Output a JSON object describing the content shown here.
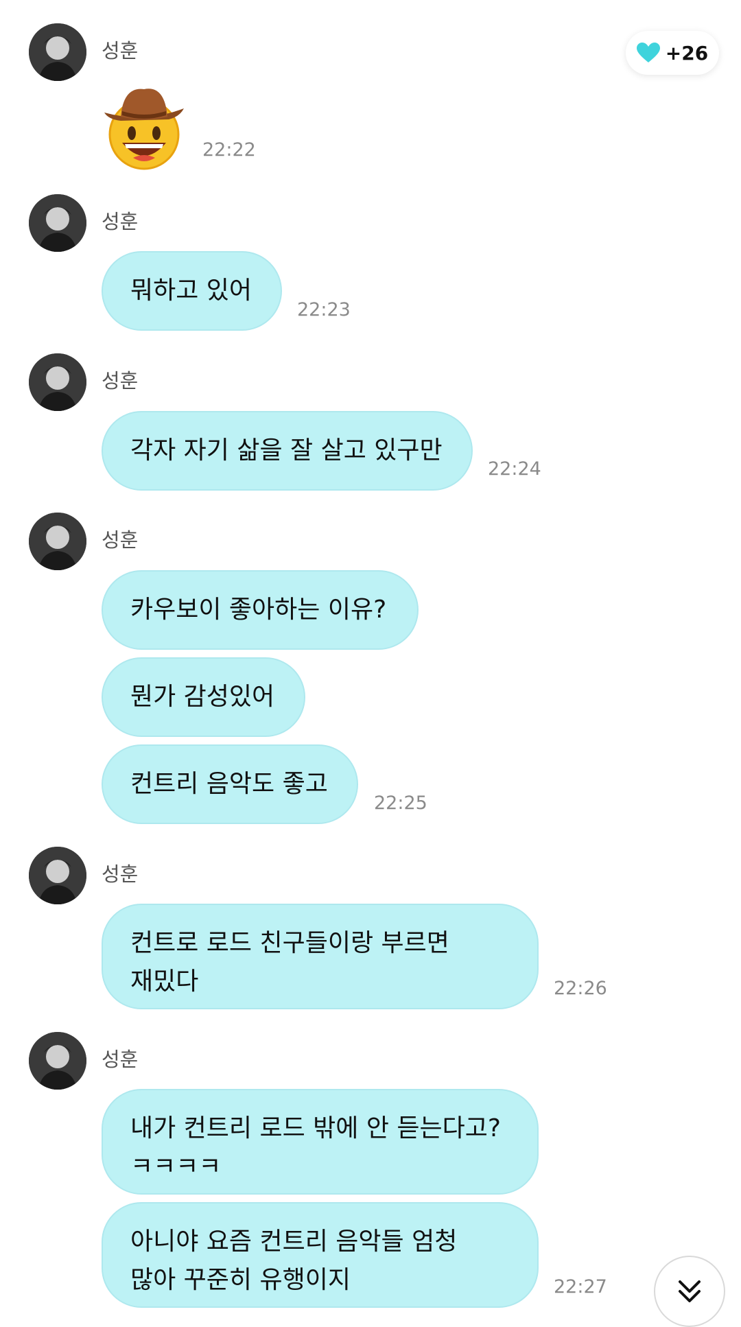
{
  "heart_badge": {
    "count": "+26",
    "color": "#3fd3dc"
  },
  "sender": "성훈",
  "messages": [
    {
      "name": "성훈",
      "emoji": "cowboy-hat-face",
      "time": "22:22"
    },
    {
      "name": "성훈",
      "bubbles": [
        "뭐하고 있어"
      ],
      "time": "22:23"
    },
    {
      "name": "성훈",
      "bubbles": [
        "각자 자기 삶을 잘 살고 있구만"
      ],
      "time": "22:24"
    },
    {
      "name": "성훈",
      "bubbles": [
        "카우보이 좋아하는 이유?",
        "뭔가 감성있어",
        "컨트리 음악도 좋고"
      ],
      "time": "22:25"
    },
    {
      "name": "성훈",
      "bubbles": [
        "컨트로 로드 친구들이랑 부르면\n재밌다"
      ],
      "time": "22:26"
    },
    {
      "name": "성훈",
      "bubbles": [
        "내가 컨트리 로드 밖에 안 듣는다고?\nㅋㅋㅋㅋ",
        "아니야 요즘 컨트리 음악들 엄청\n많아 꾸준히 유행이지"
      ],
      "time": "22:27"
    }
  ],
  "bubble_color": "#bdf2f5",
  "scroll_button_icon": "double-chevron-down-icon"
}
